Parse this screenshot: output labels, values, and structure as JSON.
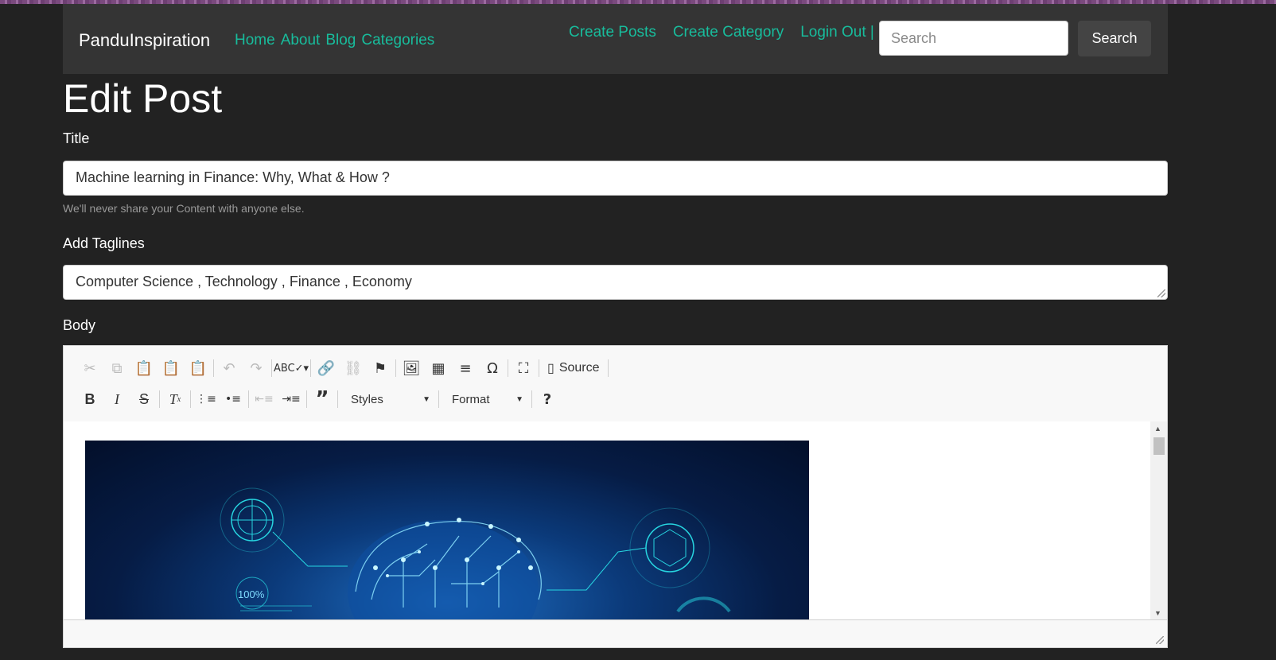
{
  "navbar": {
    "brand": "PanduInspiration",
    "links": [
      "Home",
      "About",
      "Blog",
      "Categories"
    ],
    "right_links": [
      "Create Posts",
      "Create Category",
      "Login Out |"
    ],
    "search_placeholder": "Search",
    "search_button": "Search"
  },
  "page": {
    "heading": "Edit Post",
    "title_label": "Title",
    "title_value": "Machine learning in Finance: Why, What & How ?",
    "title_help": "We'll never share your Content with anyone else.",
    "tagline_label": "Add Taglines",
    "tagline_value": "Computer Science , Technology , Finance , Economy",
    "body_label": "Body"
  },
  "editor": {
    "source_label": "Source",
    "styles_label": "Styles",
    "format_label": "Format",
    "image_caption": "100%"
  },
  "colors": {
    "background": "#222222",
    "navbar": "#343434",
    "link": "#18bc9c"
  }
}
